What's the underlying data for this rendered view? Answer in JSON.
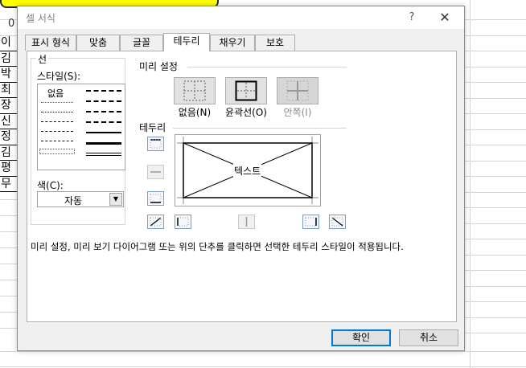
{
  "sheet": {
    "cell_value": "0",
    "column_a": [
      "이",
      "김",
      "박",
      "최",
      "장",
      "신",
      "정",
      "김",
      "평",
      "무"
    ]
  },
  "dialog": {
    "title": "셀 서식",
    "help": "?",
    "close": "✕",
    "tabs": [
      "표시 형식",
      "맞춤",
      "글꼴",
      "테두리",
      "채우기",
      "보호"
    ],
    "active_tab": "테두리"
  },
  "line_group": {
    "title": "선",
    "style_label": "스타일(S):",
    "style_none": "없음",
    "color_label": "색(C):",
    "color_value": "자동"
  },
  "presets": {
    "title": "미리 설정",
    "none_label": "없음(N)",
    "outline_label": "윤곽선(O)",
    "inside_label": "안쪽(I)"
  },
  "border": {
    "title": "테두리",
    "preview_text": "텍스트"
  },
  "hint": "미리 설정, 미리 보기 다이어그램 또는 위의 단추를 클릭하면 선택한 테두리 스타일이 적용됩니다.",
  "buttons": {
    "ok": "확인",
    "cancel": "취소"
  },
  "colors": {
    "accent": "#0078d7",
    "highlight": "#ffff00"
  }
}
